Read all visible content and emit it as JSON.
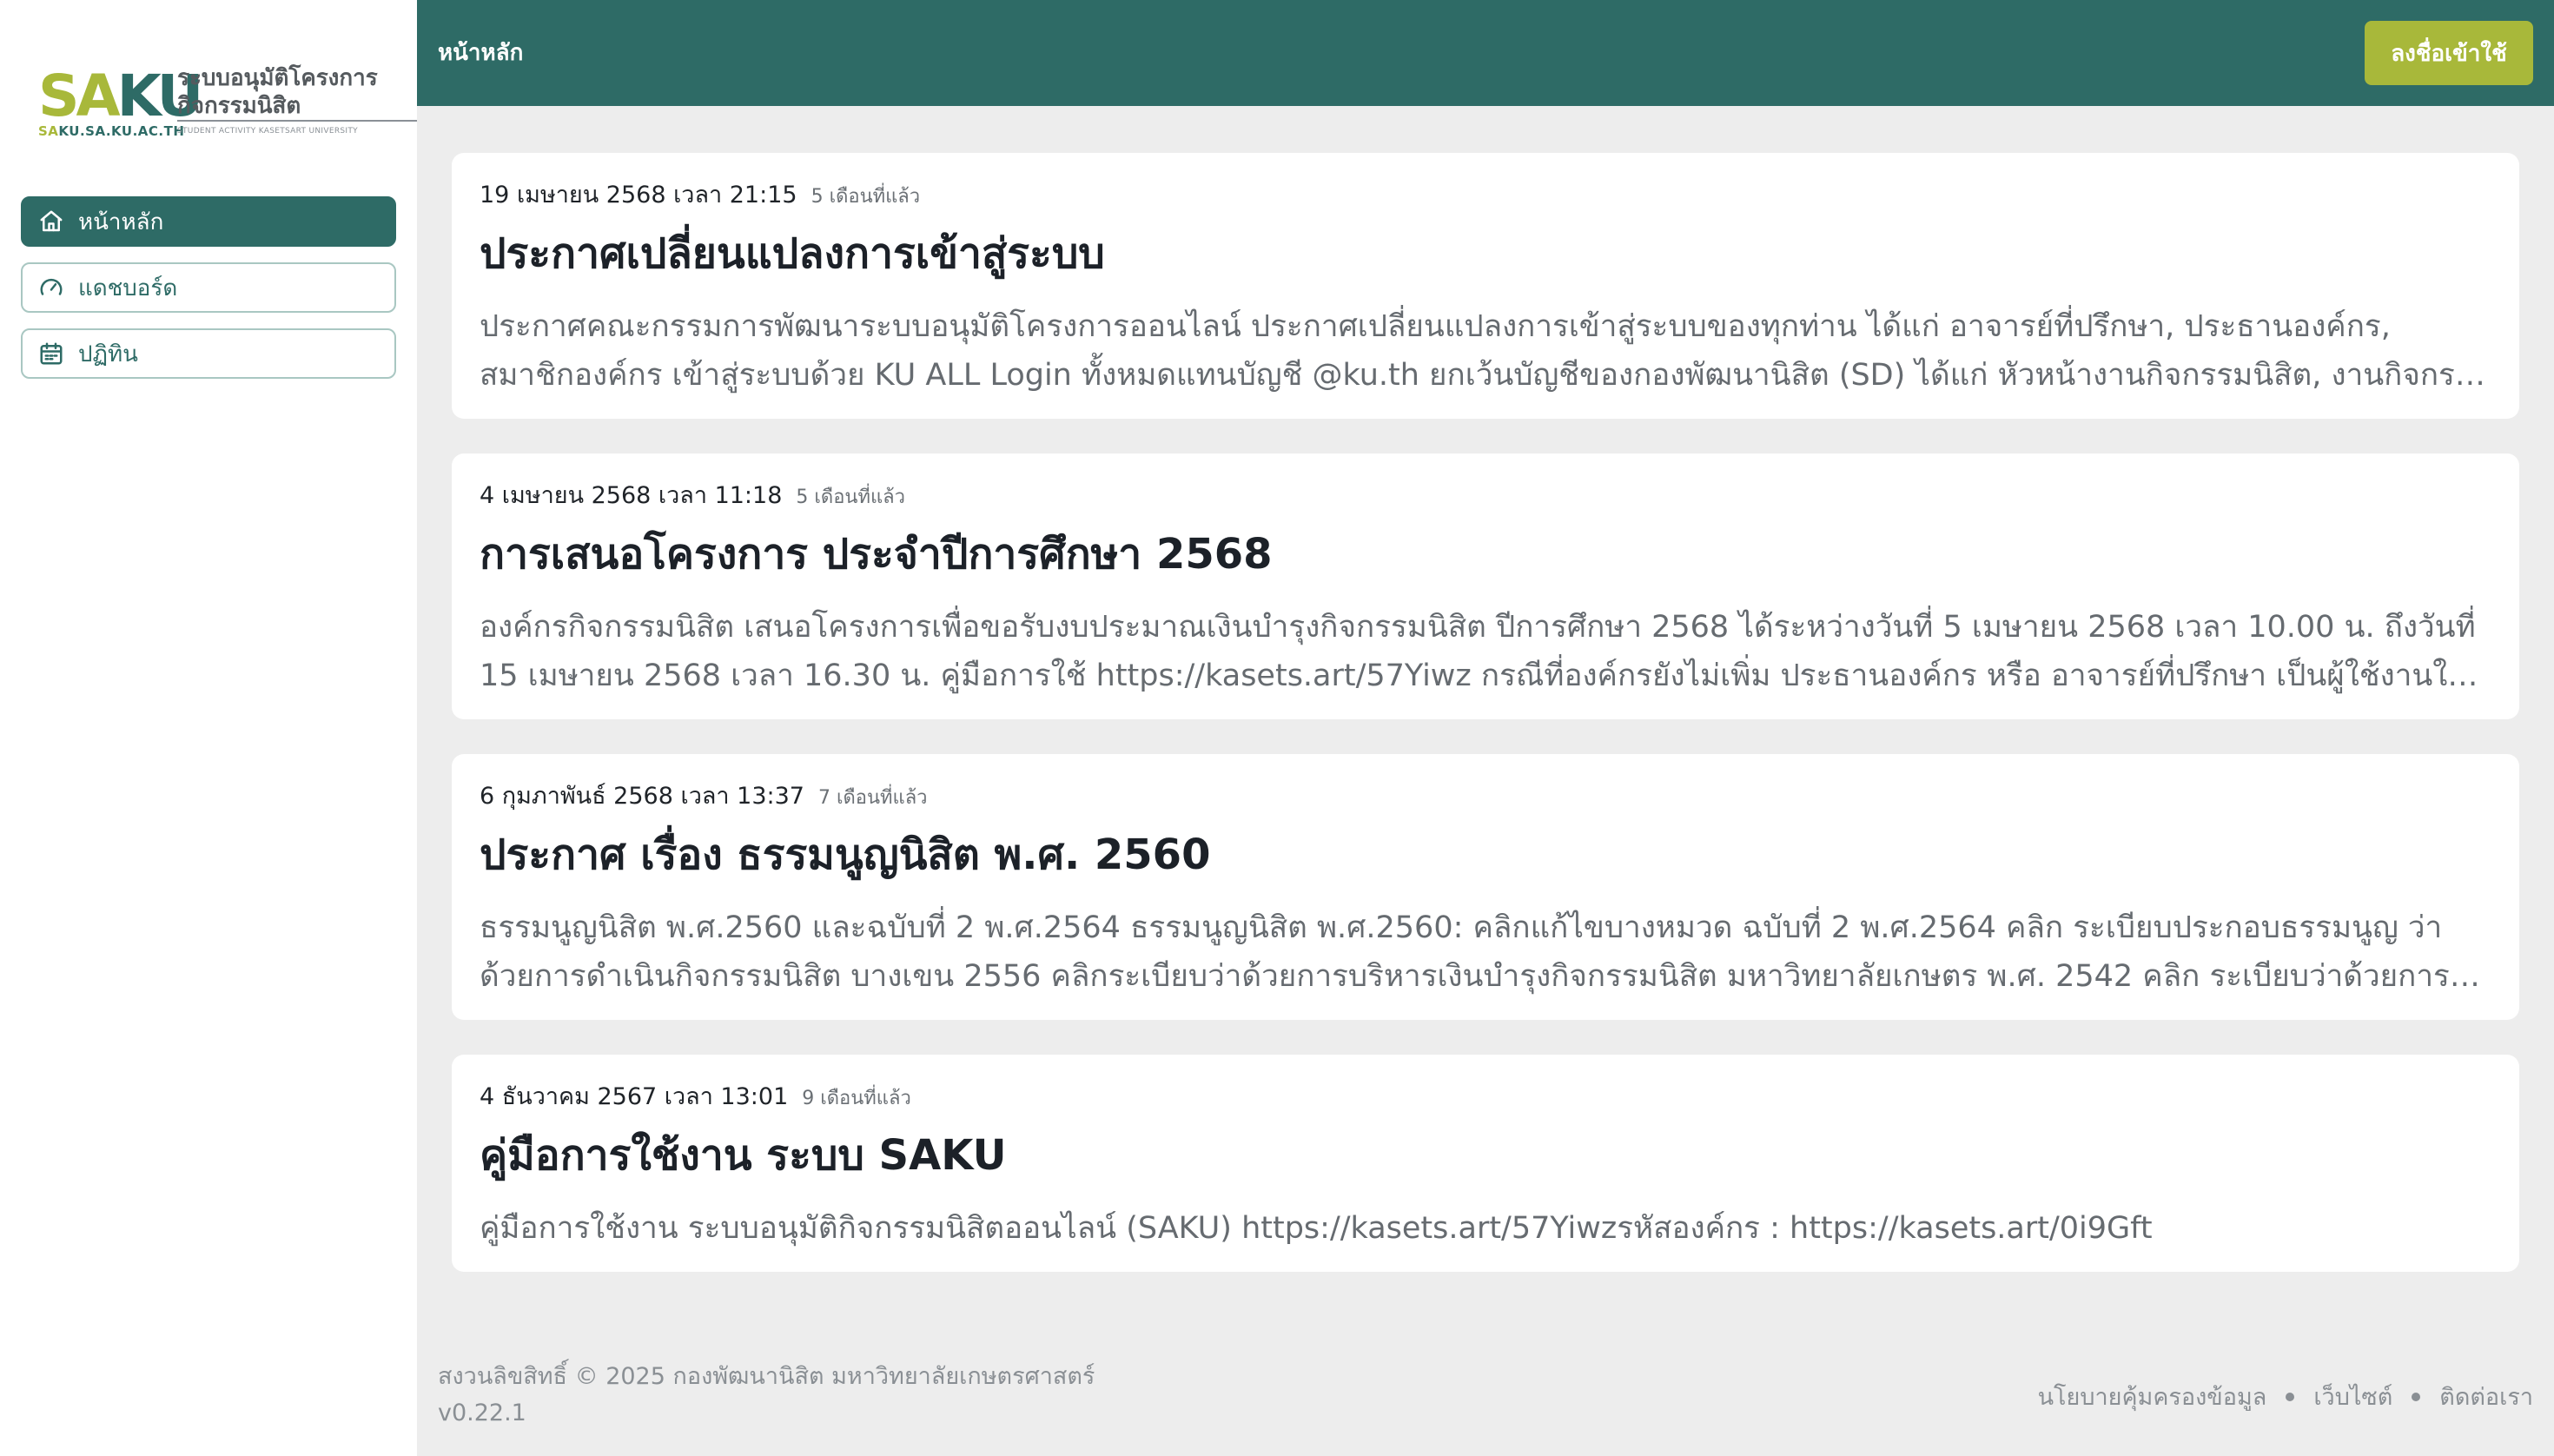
{
  "brand": {
    "mark_sa": "SA",
    "mark_ku": "KU",
    "domain_sa": "SA",
    "domain_rest": "KU.SA.KU.AC.TH",
    "title_line1": "ระบบอนุมัติโครงการ",
    "title_line2": "กิจกรรมนิสิต",
    "subtitle": "STUDENT ACTIVITY KASETSART UNIVERSITY"
  },
  "sidebar": {
    "items": [
      {
        "label": "หน้าหลัก",
        "icon": "home-icon",
        "active": true
      },
      {
        "label": "แดชบอร์ด",
        "icon": "gauge-icon",
        "active": false
      },
      {
        "label": "ปฏิทิน",
        "icon": "calendar-icon",
        "active": false
      }
    ]
  },
  "header": {
    "title": "หน้าหลัก",
    "login_label": "ลงชื่อเข้าใช้"
  },
  "announcements": [
    {
      "date": "19 เมษายน 2568 เวลา 21:15",
      "ago": "5 เดือนที่แล้ว",
      "title": "ประกาศเปลี่ยนแปลงการเข้าสู่ระบบ",
      "body": "ประกาศคณะกรรมการพัฒนาระบบอนุมัติโครงการออนไลน์ ประกาศเปลี่ยนแปลงการเข้าสู่ระบบของทุกท่าน ได้แก่ อาจารย์ที่ปรึกษา, ประธานองค์กร, สมาชิกองค์กร เข้าสู่ระบบด้วย KU ALL Login ทั้งหมดแทนบัญชี @ku.th ยกเว้นบัญชีของกองพัฒนานิสิต (SD) ได้แก่ หัวหน้างานกิจกรรมนิสิต, งานกิจกรรมนิสิต, หัวหน้าหน่วย..."
    },
    {
      "date": "4 เมษายน 2568 เวลา 11:18",
      "ago": "5 เดือนที่แล้ว",
      "title": "การเสนอโครงการ ประจำปีการศึกษา 2568",
      "body": "องค์กรกิจกรรมนิสิต เสนอโครงการเพื่อขอรับงบประมาณเงินบำรุงกิจกรรมนิสิต ปีการศึกษา 2568 ได้ระหว่างวันที่ 5 เมษายน 2568 เวลา 10.00 น. ถึงวันที่ 15 เมษายน 2568 เวลา 16.30 น. คู่มือการใช้ https://kasets.art/57Yiwz กรณีที่องค์กรยังไม่เพิ่ม ประธานองค์กร หรือ อาจารย์ที่ปรึกษา เป็นผู้ใช้งานในระบบ จะไม่..."
    },
    {
      "date": "6 กุมภาพันธ์ 2568 เวลา 13:37",
      "ago": "7 เดือนที่แล้ว",
      "title": "ประกาศ เรื่อง ธรรมนูญนิสิต พ.ศ. 2560",
      "body": "ธรรมนูญนิสิต พ.ศ.2560 และฉบับที่ 2 พ.ศ.2564 ธรรมนูญนิสิต พ.ศ.2560: คลิกแก้ไขบางหมวด ฉบับที่ 2 พ.ศ.2564 คลิก ระเบียบประกอบธรรมนูญ ว่าด้วยการดำเนินกิจกรรมนิสิต บางเขน 2556 คลิกระเบียบว่าด้วยการบริหารเงินบำรุงกิจกรรมนิสิต มหาวิทยาลัยเกษตร พ.ศ. 2542 คลิก ระเบียบว่าด้วยการบริหารเงินบำรุง..."
    },
    {
      "date": "4 ธันวาคม 2567 เวลา 13:01",
      "ago": "9 เดือนที่แล้ว",
      "title": "คู่มือการใช้งาน ระบบ SAKU",
      "body": "คู่มือการใช้งาน ระบบอนุมัติกิจกรรมนิสิตออนไลน์ (SAKU) https://kasets.art/57Yiwzรหัสองค์กร : https://kasets.art/0i9Gft"
    }
  ],
  "footer": {
    "copyright": "สงวนลิขสิทธิ์ © 2025 กองพัฒนานิสิต มหาวิทยาลัยเกษตรศาสตร์",
    "version": "v0.22.1",
    "links": [
      "นโยบายคุ้มครองข้อมูล",
      "เว็บไซต์",
      "ติดต่อเรา"
    ]
  },
  "colors": {
    "primary": "#2e6b66",
    "accent": "#a8b83a",
    "background": "#ededed"
  }
}
